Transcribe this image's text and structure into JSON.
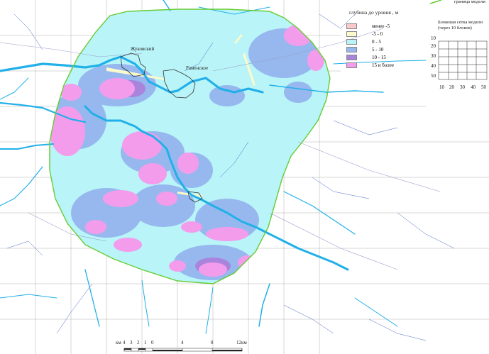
{
  "map": {
    "boundary_label": "граница модели",
    "legend_title": "глубина до уровня , м",
    "legend": [
      {
        "label": "менее -5",
        "color": "#f8c8cc"
      },
      {
        "label": "-5 - 0",
        "color": "#fafacc"
      },
      {
        "label": "0 - 5",
        "color": "#b8f4f8"
      },
      {
        "label": "5 - 10",
        "color": "#96b8ee"
      },
      {
        "label": "10 - 15",
        "color": "#a884dc"
      },
      {
        "label": "15 и более",
        "color": "#f49cec"
      }
    ],
    "cities": [
      "Жуковский",
      "Раменское"
    ],
    "grid_box": {
      "title": "Блоковая сетка модели (через 10 блоков)",
      "y_ticks": [
        "10",
        "20",
        "30",
        "40",
        "50"
      ],
      "x_ticks": [
        "10",
        "20",
        "30",
        "40",
        "50"
      ]
    },
    "scale_bar": {
      "unit_left": "км",
      "labels": [
        "4",
        "3",
        "2",
        "1",
        "0",
        "4",
        "8",
        "12км"
      ]
    },
    "colors": {
      "boundary": "#66cc33",
      "river": "#22b0e8",
      "grid": "#b0b0b0",
      "road": "#9aa0cc"
    }
  }
}
